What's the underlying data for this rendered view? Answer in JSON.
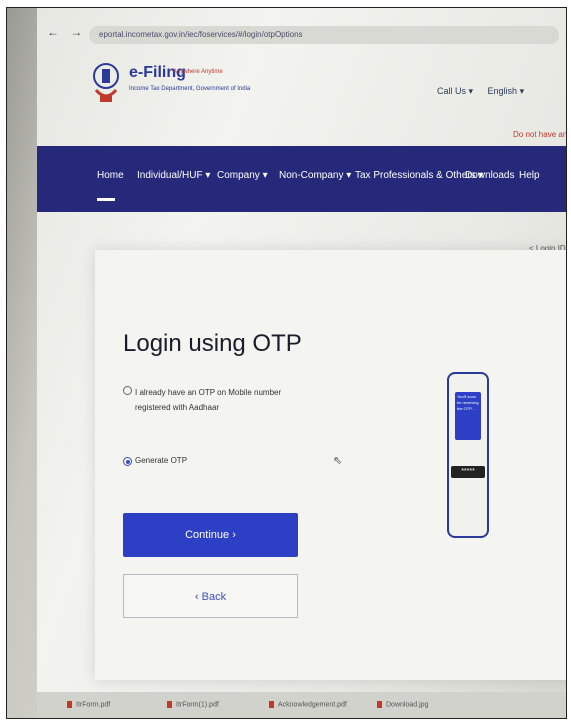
{
  "browser": {
    "nav_buttons": "← → C",
    "url": "eportal.incometax.gov.in/iec/foservices/#/login/otpOptions"
  },
  "site": {
    "logo_title": "e-Filing",
    "logo_tagline": "Anywhere Anytime",
    "logo_subtitle": "Income Tax Department, Government of India",
    "call_us": "Call Us ▾",
    "language": "English ▾",
    "notice": "Do not have an a"
  },
  "nav": {
    "items": [
      {
        "label": "Home"
      },
      {
        "label": "Individual/HUF ▾"
      },
      {
        "label": "Company ▾"
      },
      {
        "label": "Non-Company ▾"
      },
      {
        "label": "Tax Professionals & Others ▾"
      },
      {
        "label": "Downloads"
      },
      {
        "label": "Help"
      }
    ]
  },
  "breadcrumb": "< Login ID",
  "login": {
    "title": "Login using OTP",
    "option_existing": "I already have an OTP on Mobile number registered with Aadhaar",
    "option_generate": "Generate OTP",
    "selected": "generate"
  },
  "buttons": {
    "continue": "Continue  ›",
    "back": "‹  Back"
  },
  "illustration": {
    "message": "You'll soon be receiving the OTP...",
    "otp_mask": "*****"
  },
  "downloads": [
    {
      "name": "ItrForm.pdf"
    },
    {
      "name": "ItrForm(1).pdf"
    },
    {
      "name": "Acknowledgement.pdf"
    },
    {
      "name": "Download.jpg"
    }
  ]
}
